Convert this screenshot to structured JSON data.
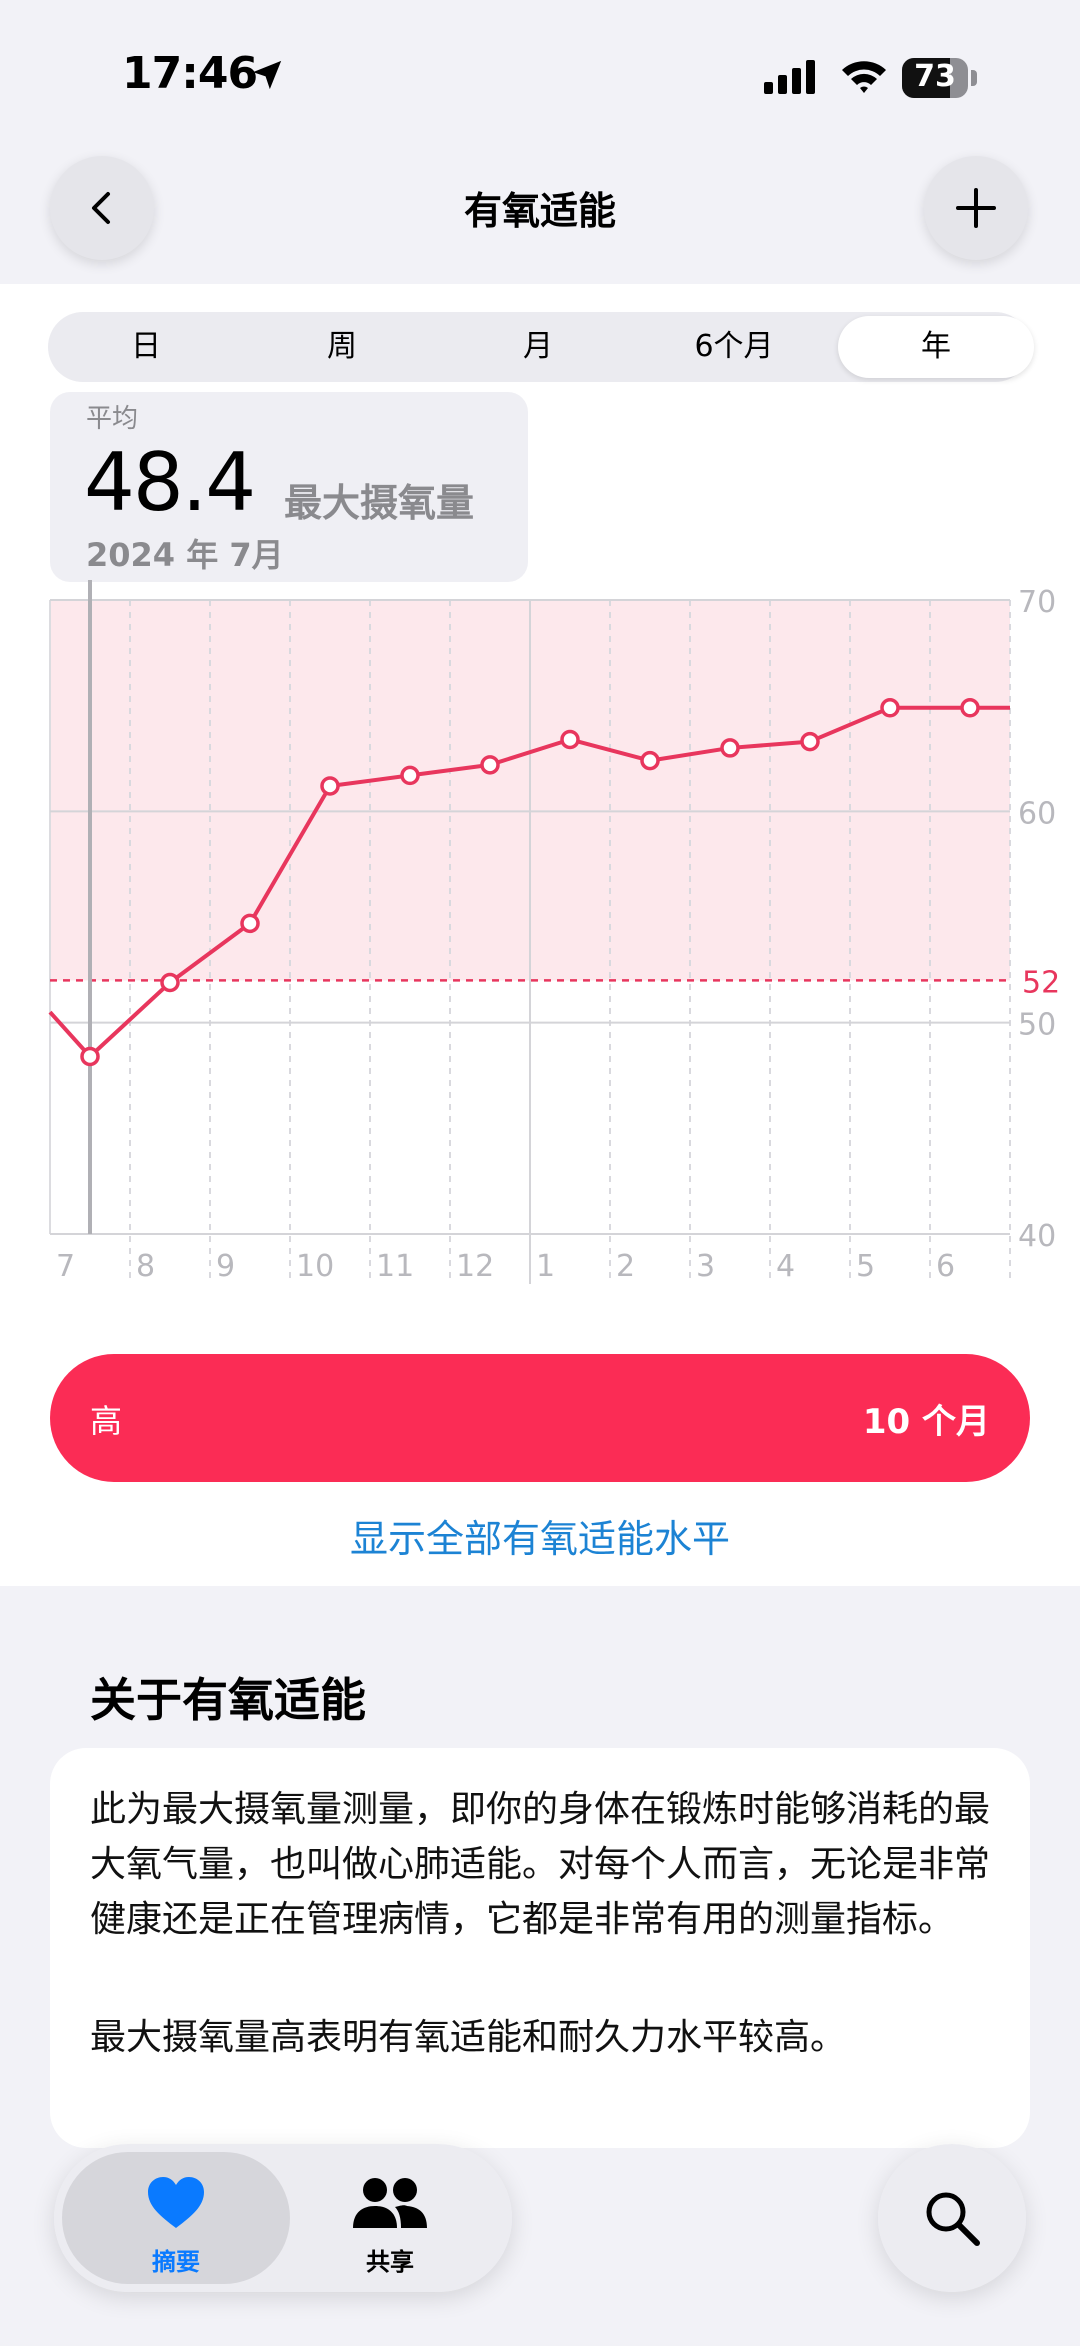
{
  "status_bar": {
    "time": "17:46",
    "battery": "73",
    "battery_level": 0.73
  },
  "nav": {
    "title": "有氧适能",
    "back_icon": "chevron-left-icon",
    "add_icon": "plus-icon"
  },
  "segments": [
    {
      "label": "日",
      "active": false
    },
    {
      "label": "周",
      "active": false
    },
    {
      "label": "月",
      "active": false
    },
    {
      "label": "6个月",
      "active": false
    },
    {
      "label": "年",
      "active": true
    }
  ],
  "summary": {
    "label": "平均",
    "value": "48.4",
    "unit": "最大摄氧量",
    "date": "2024 年 7月"
  },
  "chart_data": {
    "type": "line",
    "x_ticks": [
      "7",
      "8",
      "9",
      "10",
      "11",
      "12",
      "1",
      "2",
      "3",
      "4",
      "5",
      "6"
    ],
    "x": [
      -0.5,
      0,
      1,
      2,
      3,
      4,
      5,
      6,
      7,
      8,
      9,
      10,
      11,
      11.5
    ],
    "values": [
      50.5,
      48.4,
      51.9,
      54.7,
      61.2,
      61.7,
      62.2,
      63.4,
      62.4,
      63.0,
      63.3,
      64.9,
      64.9,
      64.9
    ],
    "ylim": [
      40,
      70
    ],
    "y_ticks": [
      "70",
      "60",
      "50",
      "40"
    ],
    "reference_line": {
      "value": 52,
      "label": "52"
    },
    "high_range": [
      52,
      70
    ],
    "selected_index": 1,
    "line_color": "#E8365D",
    "band_color": "#FDE8EC",
    "grid": true
  },
  "level": {
    "name": "高",
    "duration": "10 个月",
    "color": "#FB2C55"
  },
  "show_all_label": "显示全部有氧适能水平",
  "about": {
    "title": "关于有氧适能",
    "paragraph1": "此为最大摄氧量测量，即你的身体在锻炼时能够消耗的最大氧气量，也叫做心肺适能。对每个人而言，无论是非常健康还是正在管理病情，它都是非常有用的测量指标。",
    "paragraph2": "最大摄氧量高表明有氧适能和耐久力水平较高。"
  },
  "tabbar": {
    "items": [
      {
        "label": "摘要",
        "icon": "heart-icon",
        "active": true
      },
      {
        "label": "共享",
        "icon": "people-icon",
        "active": false
      }
    ],
    "search_icon": "search-icon"
  }
}
